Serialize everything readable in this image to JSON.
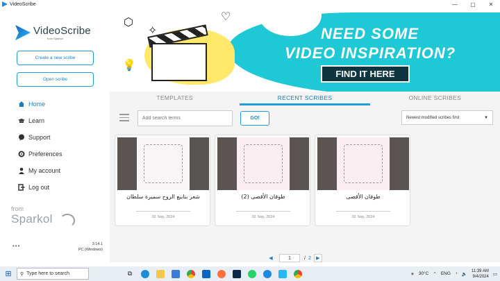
{
  "window": {
    "title": "VideoScribe",
    "minimize": "—",
    "maximize": "▢",
    "close": "✕"
  },
  "sidebar": {
    "brand": "VideoScribe",
    "brand_sub": "from Sparkol",
    "create_button": "Create a new scribe",
    "open_button": "Open scribe",
    "nav": [
      {
        "label": "Home",
        "icon": "home-icon",
        "active": true
      },
      {
        "label": "Learn",
        "icon": "graduation-cap-icon",
        "active": false
      },
      {
        "label": "Support",
        "icon": "support-bubble-icon",
        "active": false
      },
      {
        "label": "Preferences",
        "icon": "gear-icon",
        "active": false
      },
      {
        "label": "My account",
        "icon": "user-icon",
        "active": false
      },
      {
        "label": "Log out",
        "icon": "logout-icon",
        "active": false
      }
    ],
    "from_label": "from",
    "from_brand": "Sparkol",
    "more": "•••",
    "version": "3.14.1",
    "platform": "PC (Windows)"
  },
  "banner": {
    "line1": "NEED SOME",
    "line2": "VIDEO INSPIRATION?",
    "cta": "FIND IT HERE",
    "bg_color": "#1ec9d5"
  },
  "tabs": [
    {
      "label": "TEMPLATES",
      "active": false
    },
    {
      "label": "RECENT SCRIBES",
      "active": true
    },
    {
      "label": "ONLINE SCRIBES",
      "active": false
    }
  ],
  "toolbar": {
    "search_placeholder": "Add search terms",
    "go_label": "GO!",
    "sort_value": "Newest modified scribes first"
  },
  "scribes": [
    {
      "title": "شعر بنابيع الروح سميرة سلطان",
      "date": "02 Sep, 2024"
    },
    {
      "title": "طوفان الأقصى (2)",
      "date": "02 Sep, 2024"
    },
    {
      "title": "طوفان الأقصى",
      "date": "02 Sep, 2024"
    }
  ],
  "pager": {
    "current": "1",
    "separator": "/",
    "total": "2"
  },
  "taskbar": {
    "search_placeholder": "Type here to search",
    "temperature": "30°C",
    "time": "11:39 AM",
    "date": "9/4/2024",
    "lang": "ENG"
  },
  "colors": {
    "accent": "#1ea0d7",
    "accent_text": "#1a7fb8"
  }
}
